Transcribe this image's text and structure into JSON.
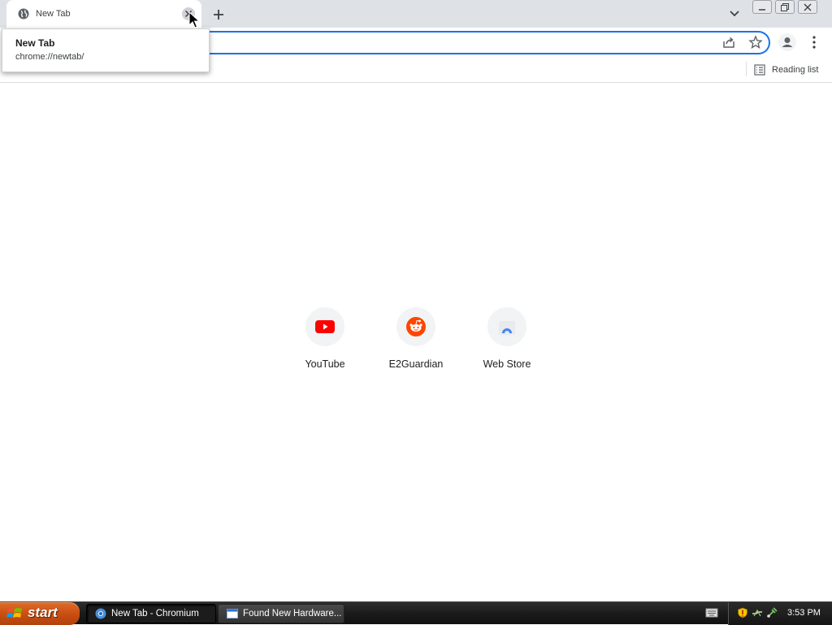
{
  "tab": {
    "title": "New Tab"
  },
  "hover_card": {
    "title": "New Tab",
    "url": "chrome://newtab/"
  },
  "bookmarks_bar": {
    "reading_list_label": "Reading list"
  },
  "shortcuts": [
    {
      "label": "YouTube",
      "icon": "youtube-icon",
      "color": "#ff0000"
    },
    {
      "label": "E2Guardian",
      "icon": "reddit-icon",
      "color": "#ff4500"
    },
    {
      "label": "Web Store",
      "icon": "web-store-icon",
      "color": "#4285f4"
    }
  ],
  "taskbar": {
    "start_label": "start",
    "items": [
      {
        "label": "New Tab - Chromium",
        "icon": "chromium-icon",
        "active": true
      },
      {
        "label": "Found New Hardware...",
        "icon": "window-icon",
        "active": false
      }
    ],
    "clock": "3:53 PM"
  },
  "colors": {
    "accent": "#1a73e8",
    "tab_strip": "#dee1e6",
    "start_button": "#c84d10"
  }
}
